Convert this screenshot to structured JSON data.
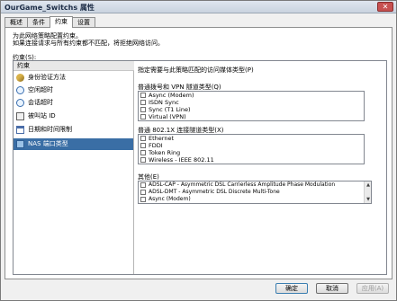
{
  "window": {
    "title": "OurGame_Switchs 属性",
    "close_glyph": "✕"
  },
  "tabs": [
    {
      "label": "概述",
      "active": false
    },
    {
      "label": "条件",
      "active": false
    },
    {
      "label": "约束",
      "active": true
    },
    {
      "label": "设置",
      "active": false
    }
  ],
  "panel": {
    "description_line1": "为此网络策略配置约束。",
    "description_line2": "如果连接请求与所有约束都不匹配，将拒绝网络访问。",
    "constraints_label": "约束(S):"
  },
  "constraint_list": {
    "header": "约束",
    "items": [
      {
        "label": "身份验证方法",
        "icon": "key-icon",
        "selected": false
      },
      {
        "label": "空闲超时",
        "icon": "clock-icon",
        "selected": false
      },
      {
        "label": "会话超时",
        "icon": "clock-icon",
        "selected": false
      },
      {
        "label": "被叫站 ID",
        "icon": "id-card-icon",
        "selected": false
      },
      {
        "label": "日期和时间限制",
        "icon": "calendar-icon",
        "selected": false
      },
      {
        "label": "NAS 端口类型",
        "icon": "network-port-icon",
        "selected": true
      }
    ]
  },
  "details": {
    "title": "指定需要与此策略匹配的访问媒体类型(P)",
    "groups": [
      {
        "label": "普通拨号和 VPN 隧道类型(Q)",
        "items": [
          "Async (Modem)",
          "ISDN Sync",
          "Sync (T1 Line)",
          "Virtual (VPN)"
        ]
      },
      {
        "label": "普通 802.1X 连接隧道类型(X)",
        "items": [
          "Ethernet",
          "FDDI",
          "Token Ring",
          "Wireless - IEEE 802.11"
        ]
      },
      {
        "label": "其他(E)",
        "items": [
          "ADSL-CAP - Asymmetric DSL Carrierless Amplitude Phase Modulation",
          "ADSL-DMT - Asymmetric DSL Discrete Multi-Tone",
          "Async (Modem)"
        ]
      }
    ]
  },
  "buttons": {
    "ok": "确定",
    "cancel": "取消",
    "apply": "应用(A)"
  }
}
